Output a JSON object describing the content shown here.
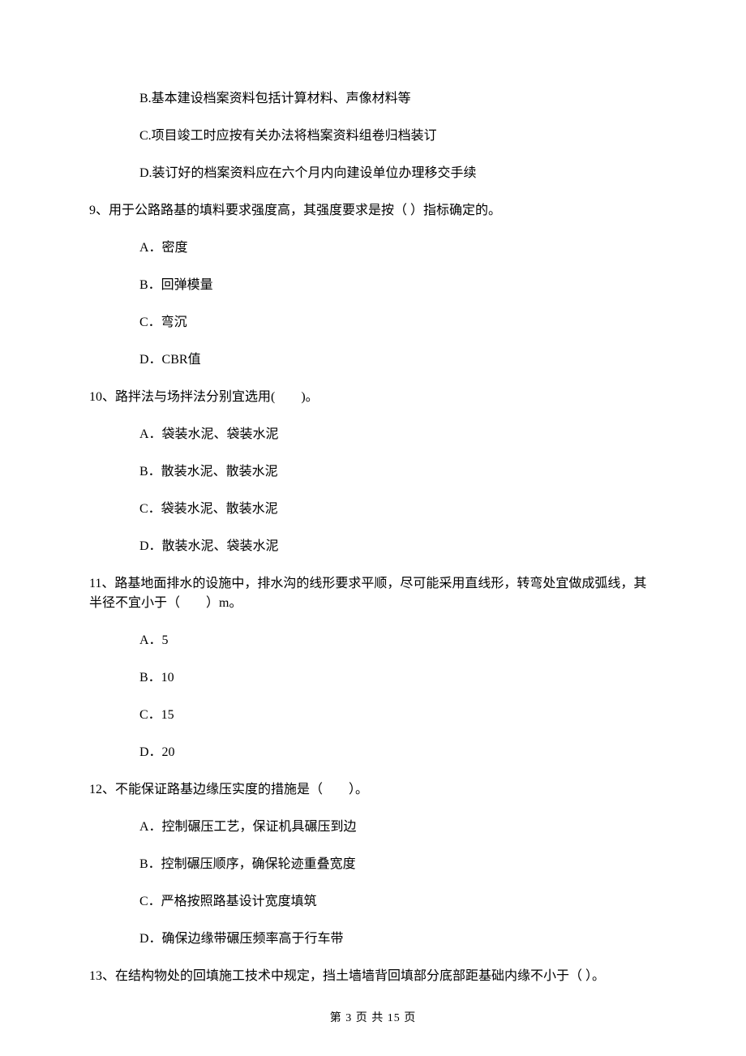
{
  "q8": {
    "B": "B.基本建设档案资料包括计算材料、声像材料等",
    "C": "C.项目竣工时应按有关办法将档案资料组卷归档装订",
    "D": "D.装订好的档案资料应在六个月内向建设单位办理移交手续"
  },
  "q9": {
    "stem": "9、用于公路路基的填料要求强度高，其强度要求是按（   ）指标确定的。",
    "A": "A．密度",
    "B": "B．回弹模量",
    "C": "C．弯沉",
    "D": "D．CBR值"
  },
  "q10": {
    "stem": "10、路拌法与场拌法分别宜选用(　　)。",
    "A": "A．袋装水泥、袋装水泥",
    "B": "B．散装水泥、散装水泥",
    "C": "C．袋装水泥、散装水泥",
    "D": "D．散装水泥、袋装水泥"
  },
  "q11": {
    "stem": "11、路基地面排水的设施中，排水沟的线形要求平顺，尽可能采用直线形，转弯处宜做成弧线，其半径不宜小于（　　）m。",
    "A": "A．5",
    "B": "B．10",
    "C": "C．15",
    "D": "D．20"
  },
  "q12": {
    "stem": "12、不能保证路基边缘压实度的措施是（　　）。",
    "A": "A．控制碾压工艺，保证机具碾压到边",
    "B": "B．控制碾压顺序，确保轮迹重叠宽度",
    "C": "C．严格按照路基设计宽度填筑",
    "D": "D．确保边缘带碾压频率高于行车带"
  },
  "q13": {
    "stem": "13、在结构物处的回填施工技术中规定，挡土墙墙背回填部分底部距基础内缘不小于（   ）。"
  },
  "footer": "第 3 页 共 15 页"
}
